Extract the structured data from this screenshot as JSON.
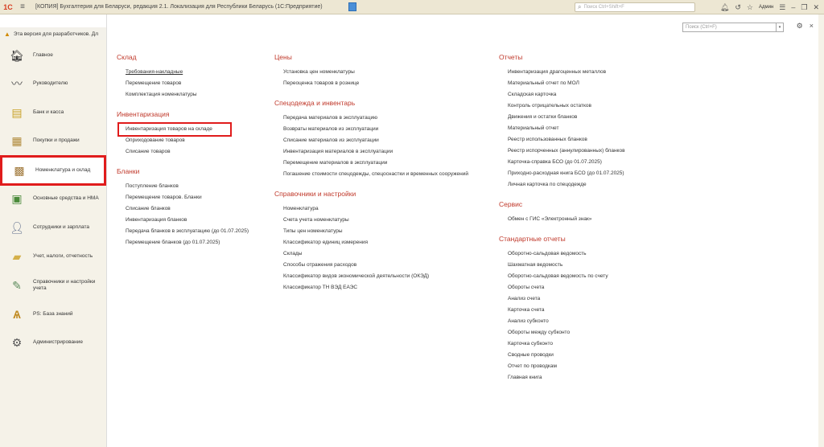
{
  "titlebar": {
    "logo": "1С",
    "title": "[КОПИЯ] Бухгалтерия для Беларуси, редакция 2.1. Локализация для Республики Беларусь   (1С:Предприятие)",
    "search_placeholder": "Поиск Ctrl+Shift+F",
    "user": "Админ"
  },
  "devbar": {
    "text": "Эта версия для разработчиков. Дл"
  },
  "sidebar": {
    "items": [
      {
        "label": "Главное",
        "icon": "main-icon"
      },
      {
        "label": "Руководителю",
        "icon": "chart-icon"
      },
      {
        "label": "Банк и касса",
        "icon": "bank-icon"
      },
      {
        "label": "Покупки и продажи",
        "icon": "cart-icon"
      },
      {
        "label": "Номенклатура и склад",
        "icon": "warehouse-icon"
      },
      {
        "label": "Основные средства и НМА",
        "icon": "assets-icon"
      },
      {
        "label": "Сотрудники и зарплата",
        "icon": "people-icon"
      },
      {
        "label": "Учет, налоги, отчетность",
        "icon": "folder-icon"
      },
      {
        "label": "Справочники и настройки учета",
        "icon": "settings-doc-icon"
      },
      {
        "label": "PS: База знаний",
        "icon": "knowledge-icon"
      },
      {
        "label": "Администрирование",
        "icon": "gear-icon"
      }
    ]
  },
  "main": {
    "search_placeholder": "Поиск (Ctrl+F)",
    "col1": {
      "sklad": {
        "title": "Склад",
        "links": [
          "Требования-накладные",
          "Перемещение товаров",
          "Комплектация номенклатуры"
        ]
      },
      "inv": {
        "title": "Инвентаризация",
        "links": [
          "Инвентаризация товаров на складе",
          "Оприходование товаров",
          "Списание товаров"
        ]
      },
      "blanki": {
        "title": "Бланки",
        "links": [
          "Поступление бланков",
          "Перемещение товаров. Бланки",
          "Списание бланков",
          "Инвентаризация бланков",
          "Передача бланков в эксплуатацию (до 01.07.2025)",
          "Перемещение бланков (до 01.07.2025)"
        ]
      }
    },
    "col2": {
      "ceny": {
        "title": "Цены",
        "links": [
          "Установка цен номенклатуры",
          "Переоценка товаров в рознице"
        ]
      },
      "spec": {
        "title": "Спецодежда и инвентарь",
        "links": [
          "Передача материалов в эксплуатацию",
          "Возвраты материалов из эксплуатации",
          "Списание материалов из эксплуатации",
          "Инвентаризация материалов в эксплуатации",
          "Перемещение материалов в эксплуатации",
          "Погашение стоимости спецодежды, спецоснастки и временных сооружений"
        ]
      },
      "sprav": {
        "title": "Справочники и настройки",
        "links": [
          "Номенклатура",
          "Счета учета номенклатуры",
          "Типы цен номенклатуры",
          "Классификатор единиц измерения",
          "Склады",
          "Способы отражения расходов",
          "Классификатор видов экономической деятельности (ОКЭД)",
          "Классификатор ТН ВЭД ЕАЭС"
        ]
      }
    },
    "col3": {
      "otchety": {
        "title": "Отчеты",
        "links": [
          "Инвентаризация драгоценных металлов",
          "Материальный отчет по МОЛ",
          "Складская карточка",
          "Контроль отрицательных остатков",
          "Движения и остатки бланков",
          "Материальный отчет",
          "Реестр использованных бланков",
          "Реестр испорченных (аннулированных) бланков",
          "Карточка-справка БСО (до 01.07.2025)",
          "Приходно-расходная книга БСО (до 01.07.2025)",
          "Личная карточка по спецодежде"
        ]
      },
      "servis": {
        "title": "Сервис",
        "links": [
          "Обмен с ГИС «Электронный знак»"
        ]
      },
      "std": {
        "title": "Стандартные отчеты",
        "links": [
          "Оборотно-сальдовая ведомость",
          "Шахматная ведомость",
          "Оборотно-сальдовая ведомость по счету",
          "Обороты счета",
          "Анализ счета",
          "Карточка счета",
          "Анализ субконто",
          "Обороты между субконто",
          "Карточка субконто",
          "Сводные проводки",
          "Отчет по проводкам",
          "Главная книга"
        ]
      }
    }
  }
}
